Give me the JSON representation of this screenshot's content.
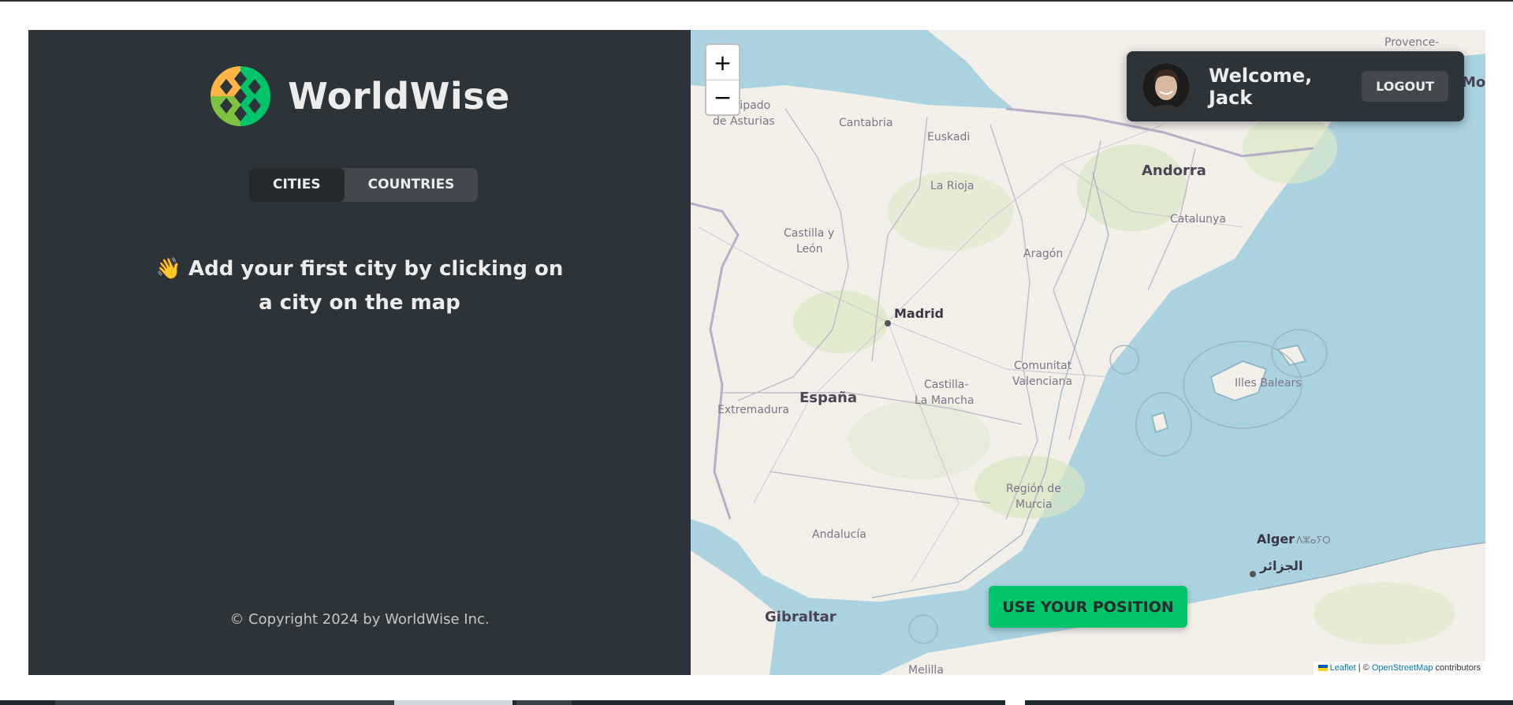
{
  "app": {
    "name": "WorldWise"
  },
  "tabs": [
    {
      "label": "CITIES",
      "active": true
    },
    {
      "label": "COUNTRIES",
      "active": false
    }
  ],
  "message": {
    "emoji": "👋",
    "text": "Add your first city by clicking on a city on the map"
  },
  "footer": {
    "copyright": "© Copyright 2024 by WorldWise Inc."
  },
  "user": {
    "welcome": "Welcome, Jack",
    "logout_label": "LOGOUT"
  },
  "map": {
    "zoom_in": "+",
    "zoom_out": "−",
    "position_button": "USE YOUR POSITION",
    "attribution": {
      "leaflet": "Leaflet",
      "separator": " | © ",
      "osm": "OpenStreetMap",
      "suffix": " contributors"
    },
    "labels": {
      "principado": "Principado",
      "asturias": "de Asturias",
      "cantabria": "Cantabria",
      "euskadi": "Euskadi",
      "provence": "Provence-",
      "andorra": "Andorra",
      "catalunya": "Catalunya",
      "larioja": "La Rioja",
      "castilla_y": "Castilla y",
      "leon": "León",
      "aragon": "Aragón",
      "madrid": "Madrid",
      "espana": "España",
      "extremadura": "Extremadura",
      "castilla_la": "Castilla-",
      "la_mancha": "La Mancha",
      "comunitat": "Comunitat",
      "valenciana": "Valenciana",
      "illes_balears": "Illes Balears",
      "region_de": "Región de",
      "murcia": "Murcia",
      "andalucia": "Andalucía",
      "gibraltar": "Gibraltar",
      "alger": "Alger",
      "alger_berber": "ⴷⵣⴰⵢⵔ",
      "alger_arabic": "الجزائر",
      "melilla": "Melilla",
      "mon": "Mon"
    }
  },
  "colors": {
    "sidebar": "#2d3439",
    "tab_active": "#242a2e",
    "tab_bar": "#42484d",
    "brand_green": "#00c46a",
    "brand_orange": "#ffb545",
    "sea": "#aad3df",
    "land": "#f2efe9"
  }
}
